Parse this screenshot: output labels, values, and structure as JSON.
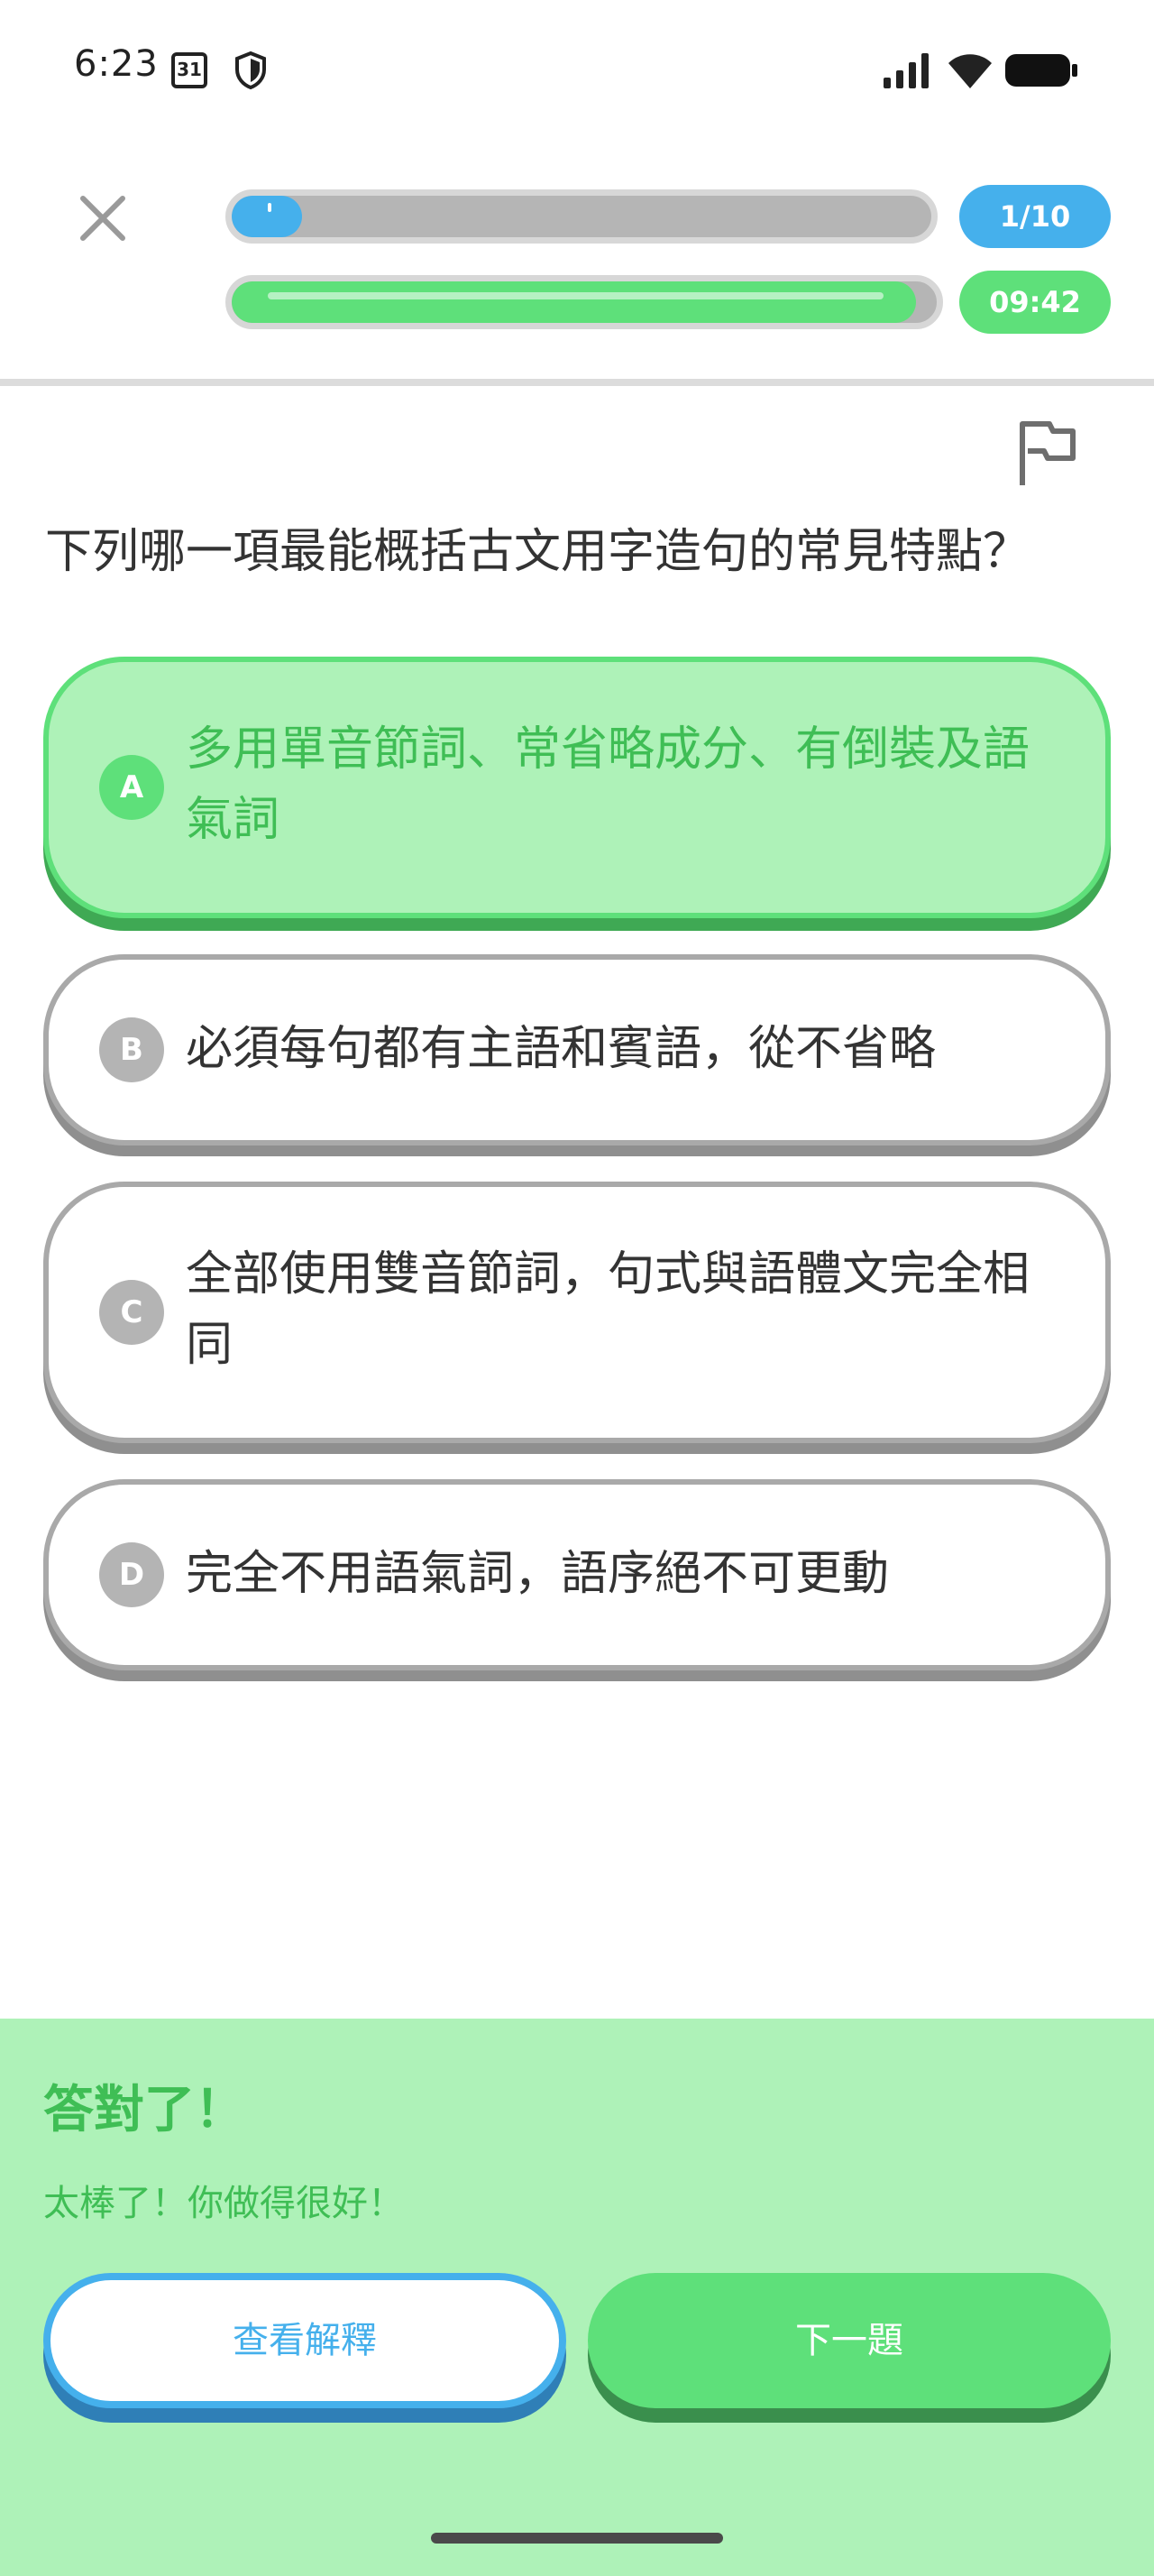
{
  "status_bar": {
    "time": "6:23",
    "calendar_day": "31"
  },
  "header": {
    "progress_counter": "1/10",
    "progress_fraction": 0.1,
    "timer_text": "09:42",
    "timer_fraction": 0.97
  },
  "question": {
    "text": "下列哪一項最能概括古文用字造句的常見特點？"
  },
  "options": [
    {
      "letter": "A",
      "text": "多用單音節詞、常省略成分、有倒裝及語氣詞",
      "selected": true
    },
    {
      "letter": "B",
      "text": "必須每句都有主語和賓語，從不省略",
      "selected": false
    },
    {
      "letter": "C",
      "text": "全部使用雙音節詞，句式與語體文完全相同",
      "selected": false
    },
    {
      "letter": "D",
      "text": "完全不用語氣詞，語序絕不可更動",
      "selected": false
    }
  ],
  "feedback": {
    "title": "答對了！",
    "subtitle": "太棒了！你做得很好！",
    "explain_label": "查看解釋",
    "next_label": "下一題"
  },
  "colors": {
    "correct_green": "#5ee07a",
    "correct_bg": "#aef2b8",
    "accent_blue": "#45b0ec",
    "neutral_gray": "#b4b4b4"
  },
  "icons": {
    "close": "close-icon",
    "flag": "flag-icon"
  }
}
